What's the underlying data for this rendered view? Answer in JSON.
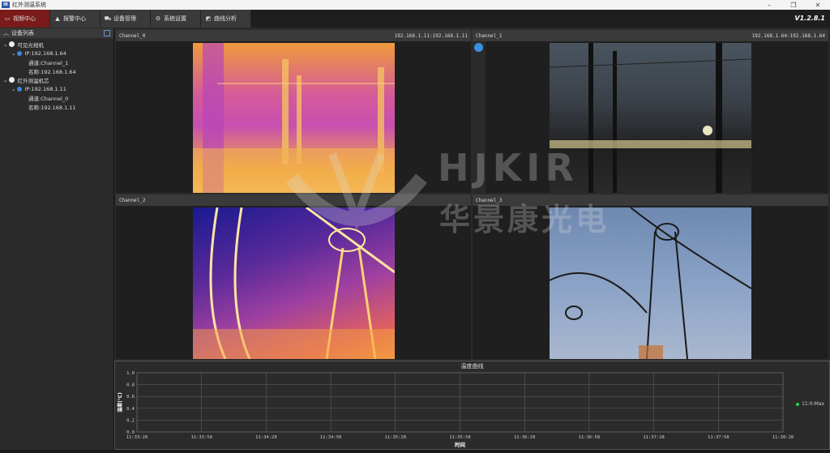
{
  "window": {
    "title": "红外测温系统",
    "logo_text": "IR",
    "minimize": "–",
    "maximize": "❐",
    "close": "✕"
  },
  "menu": {
    "items": [
      {
        "label": "视频中心",
        "icon": "▭"
      },
      {
        "label": "报警中心",
        "icon": "▲"
      },
      {
        "label": "设备管理",
        "icon": "⛟"
      },
      {
        "label": "系统设置",
        "icon": "⚙"
      },
      {
        "label": "曲线分析",
        "icon": "◩"
      }
    ],
    "version": "V1.2.8.1"
  },
  "sidebar": {
    "title": "设备列表",
    "tree": [
      {
        "group": "可见光相机",
        "device": "IP:192.168.1.64",
        "channel": "通道:Channel_1",
        "name": "名称:192.168.1.64"
      },
      {
        "group": "红外测温机芯",
        "device": "IP:192.168.1.11",
        "channel": "通道:Channel_0",
        "name": "名称:192.168.1.11"
      }
    ]
  },
  "panels": [
    {
      "name": "Channel_0",
      "info": "192.168.1.11:192.168.1.11"
    },
    {
      "name": "Channel_1",
      "info": "192.168.1.64:192.168.1.64"
    },
    {
      "name": "Channel_2",
      "info": ""
    },
    {
      "name": "Channel_3",
      "info": ""
    }
  ],
  "watermark": {
    "brand_en": "HJKIR",
    "brand_cn": "华景康光电"
  },
  "chart_data": {
    "type": "line",
    "title": "温度曲线",
    "xlabel": "时间",
    "ylabel": "温度(℃)",
    "ylim": [
      0,
      1.0
    ],
    "yticks": [
      "0.0",
      "0.2",
      "0.4",
      "0.6",
      "0.8",
      "1.0"
    ],
    "x": [
      "11:33:28",
      "11:33:58",
      "11:34:28",
      "11:34:58",
      "11:35:28",
      "11:35:58",
      "11:36:28",
      "11:36:58",
      "11:37:28",
      "11:37:58",
      "11:38:28"
    ],
    "series": [
      {
        "name": "11:0:Max",
        "values": [],
        "color": "#2fcf4f"
      }
    ],
    "grid": true,
    "legend": "right"
  }
}
